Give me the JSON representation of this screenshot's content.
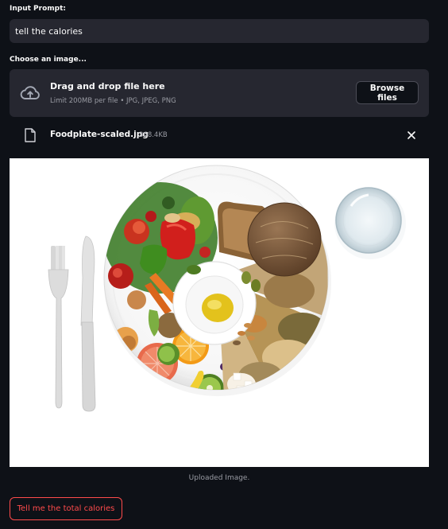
{
  "prompt": {
    "label": "Input Prompt:",
    "value": "tell the calories"
  },
  "uploader": {
    "label": "Choose an image...",
    "title": "Drag and drop file here",
    "limit": "Limit 200MB per file • JPG, JPEG, PNG",
    "browse_label": "Browse files",
    "icon": "cloud-upload-icon"
  },
  "file": {
    "name": "Foodplate-scaled.jpg",
    "size": "368.4KB",
    "icon": "file-icon",
    "remove_icon": "close-icon"
  },
  "image": {
    "caption": "Uploaded Image."
  },
  "action": {
    "label": "Tell me the total calories"
  },
  "colors": {
    "background": "#0e1117",
    "panel": "#262730",
    "accent": "#ff4b4b",
    "muted_text": "#9a9ca4"
  }
}
